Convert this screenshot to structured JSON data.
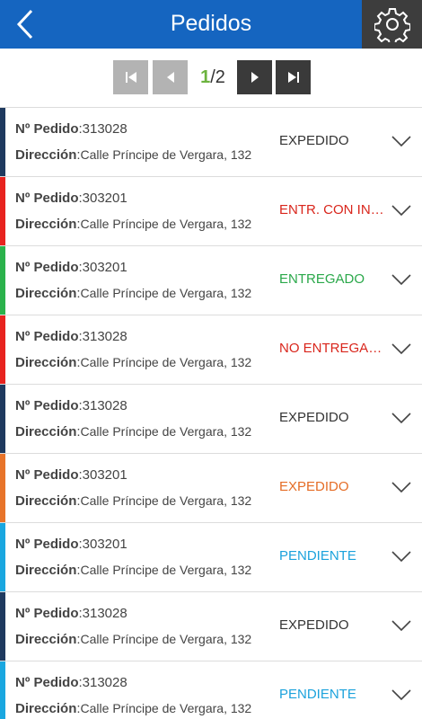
{
  "header": {
    "title": "Pedidos"
  },
  "icons": {
    "back": "chevron-left-icon",
    "settings": "gear-icon"
  },
  "pager": {
    "current": "1",
    "separator": "/",
    "total": "2"
  },
  "colors": {
    "header": "#1565c0",
    "settings_bg": "#3d3d3d",
    "expedido_dark": "#1f3a5f",
    "red": "#e8231f",
    "green": "#2bb24c",
    "orange": "#e8742a",
    "cyan": "#1aa7e0"
  },
  "labels": {
    "order": "Nº Pedido",
    "address": "Dirección"
  },
  "orders": [
    {
      "number": "313028",
      "address": "Calle Príncipe de Vergara, 132",
      "status": "EXPEDIDO",
      "bar_color": "#1f3a5f",
      "status_color": "#333333"
    },
    {
      "number": "303201",
      "address": "Calle Príncipe de Vergara, 132",
      "status": "ENTR. CON INCIDENCIA",
      "bar_color": "#e8231f",
      "status_color": "#d9261c"
    },
    {
      "number": "303201",
      "address": "Calle Príncipe de Vergara, 132",
      "status": "ENTREGADO",
      "bar_color": "#2bb24c",
      "status_color": "#2aa84a"
    },
    {
      "number": "313028",
      "address": "Calle Príncipe de Vergara, 132",
      "status": "NO ENTREGADO",
      "bar_color": "#e8231f",
      "status_color": "#d9261c"
    },
    {
      "number": "313028",
      "address": "Calle Príncipe de Vergara, 132",
      "status": "EXPEDIDO",
      "bar_color": "#1f3a5f",
      "status_color": "#333333"
    },
    {
      "number": "303201",
      "address": "Calle Príncipe de Vergara, 132",
      "status": "EXPEDIDO",
      "bar_color": "#e8742a",
      "status_color": "#e56d26"
    },
    {
      "number": "303201",
      "address": "Calle Príncipe de Vergara, 132",
      "status": "PENDIENTE",
      "bar_color": "#1aa7e0",
      "status_color": "#1ba2dc"
    },
    {
      "number": "313028",
      "address": "Calle Príncipe de Vergara, 132",
      "status": "EXPEDIDO",
      "bar_color": "#1f3a5f",
      "status_color": "#333333"
    },
    {
      "number": "313028",
      "address": "Calle Príncipe de Vergara, 132",
      "status": "PENDIENTE",
      "bar_color": "#1aa7e0",
      "status_color": "#1ba2dc"
    }
  ]
}
